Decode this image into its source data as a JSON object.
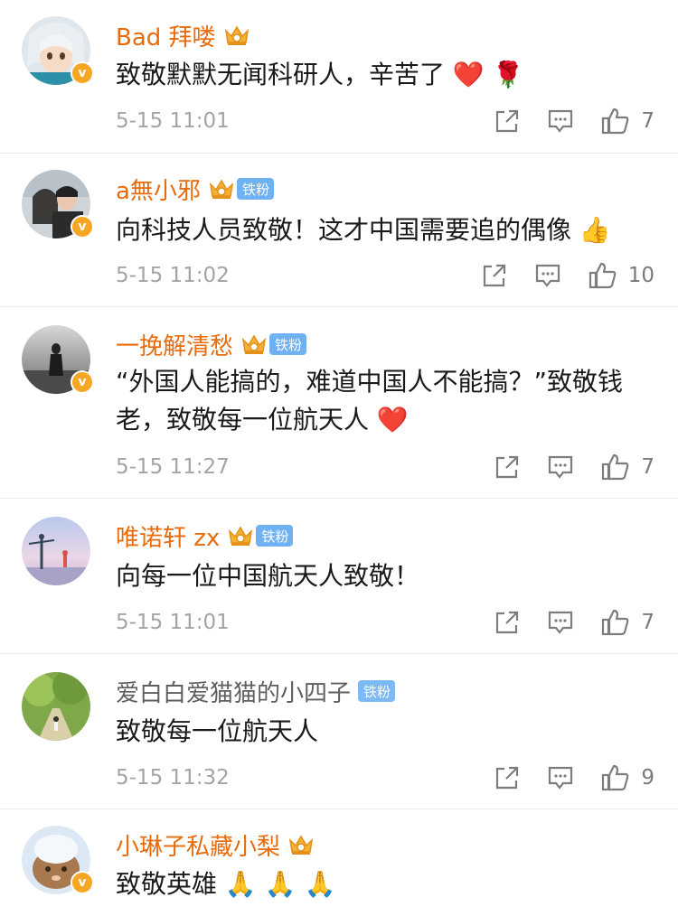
{
  "comments": [
    {
      "username": "Bad 拜喽",
      "name_style": "orange",
      "crown": true,
      "fan_badge": "",
      "text": "致敬默默无闻科研人，辛苦了",
      "emoji": "❤️ 🌹",
      "time": "5-15 11:01",
      "likes": "7"
    },
    {
      "username": "a無小邪",
      "name_style": "orange",
      "crown": true,
      "fan_badge": "铁粉",
      "text": "向科技人员致敬！这才中国需要追的偶像",
      "emoji": "👍",
      "time": "5-15 11:02",
      "likes": "10"
    },
    {
      "username": "一挽解清愁",
      "name_style": "orange",
      "crown": true,
      "fan_badge": "铁粉",
      "text": "“外国人能搞的，难道中国人不能搞？”致敬钱老，致敬每一位航天人",
      "emoji": "❤️",
      "time": "5-15 11:27",
      "likes": "7"
    },
    {
      "username": "唯诺轩 zx",
      "name_style": "orange",
      "crown": true,
      "fan_badge": "铁粉",
      "text": "向每一位中国航天人致敬！",
      "emoji": "",
      "time": "5-15 11:01",
      "likes": "7"
    },
    {
      "username": "爱白白爱猫猫的小四子",
      "name_style": "plain",
      "crown": false,
      "fan_badge": "铁粉",
      "text": "致敬每一位航天人",
      "emoji": "",
      "time": "5-15 11:32",
      "likes": "9"
    },
    {
      "username": "小琳子私藏小梨",
      "name_style": "orange",
      "crown": true,
      "fan_badge": "",
      "text": "致敬英雄",
      "emoji": "🙏 🙏 🙏",
      "time": "",
      "likes": ""
    }
  ],
  "verified_mark": "v",
  "colors": {
    "name_orange": "#e86b0c",
    "fan_badge": "#6fb2f4",
    "heart": "#e0232e",
    "verified": "#f5a623"
  },
  "icons": {
    "share": "share-icon",
    "comment": "comment-icon",
    "like": "thumbs-up-icon"
  }
}
